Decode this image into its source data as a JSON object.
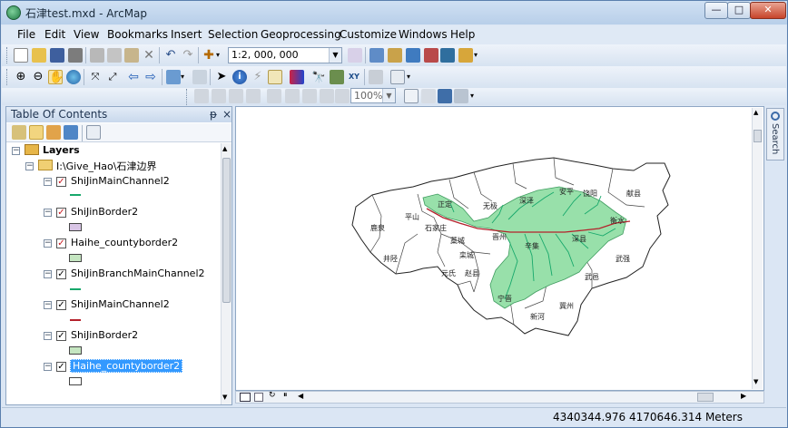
{
  "window": {
    "title": "石津test.mxd - ArcMap",
    "minimize": "—",
    "maximize": "□",
    "close": "✕"
  },
  "menu": [
    "File",
    "Edit",
    "View",
    "Bookmarks",
    "Insert",
    "Selection",
    "Geoprocessing",
    "Customize",
    "Windows",
    "Help"
  ],
  "toolbar": {
    "scale": "1:2, 000, 000",
    "zoom": "100%"
  },
  "toc": {
    "title": "Table Of Contents",
    "pin": "ᵽ",
    "close": "×",
    "root": "Layers",
    "folder": "I:\\Give_Hao\\石津边界",
    "layers": [
      {
        "name": "ShiJinMainChannel2",
        "checked_style": "red",
        "symbol": "line",
        "color": "#17a86b"
      },
      {
        "name": "ShiJinBorder2",
        "checked_style": "red",
        "symbol": "box",
        "color": "#d9c5e6"
      },
      {
        "name": "Haihe_countyborder2",
        "checked_style": "red",
        "symbol": "box",
        "color": "#c5e6c1"
      },
      {
        "name": "ShiJinBranchMainChannel2",
        "checked_style": "black",
        "symbol": "line",
        "color": "#17a86b"
      },
      {
        "name": "ShiJinMainChannel2",
        "checked_style": "black",
        "symbol": "line",
        "color": "#b4212b"
      },
      {
        "name": "ShiJinBorder2",
        "checked_style": "black",
        "symbol": "box",
        "color": "#c5e6c1"
      },
      {
        "name": "Haihe_countyborder2",
        "checked_style": "black",
        "symbol": "box",
        "color": "#ffffff",
        "selected": true
      }
    ]
  },
  "map": {
    "county_labels": [
      "正定",
      "藁城",
      "深泽",
      "安平",
      "饶阳",
      "献县",
      "平山",
      "鹿泉",
      "石家庄",
      "无极",
      "晋州",
      "辛集",
      "深县",
      "武强",
      "井陉",
      "栾城",
      "赵县",
      "宁晋",
      "冀州",
      "武邑",
      "新河",
      "衡水",
      "元氏"
    ]
  },
  "search_tab": "Search",
  "status": {
    "coordinates": "4340344.976  4170646.314 Meters"
  },
  "colors": {
    "irrigation_fill": "#98e0aa",
    "main_channel": "#b4212b",
    "branch_channel": "#17a86b"
  }
}
